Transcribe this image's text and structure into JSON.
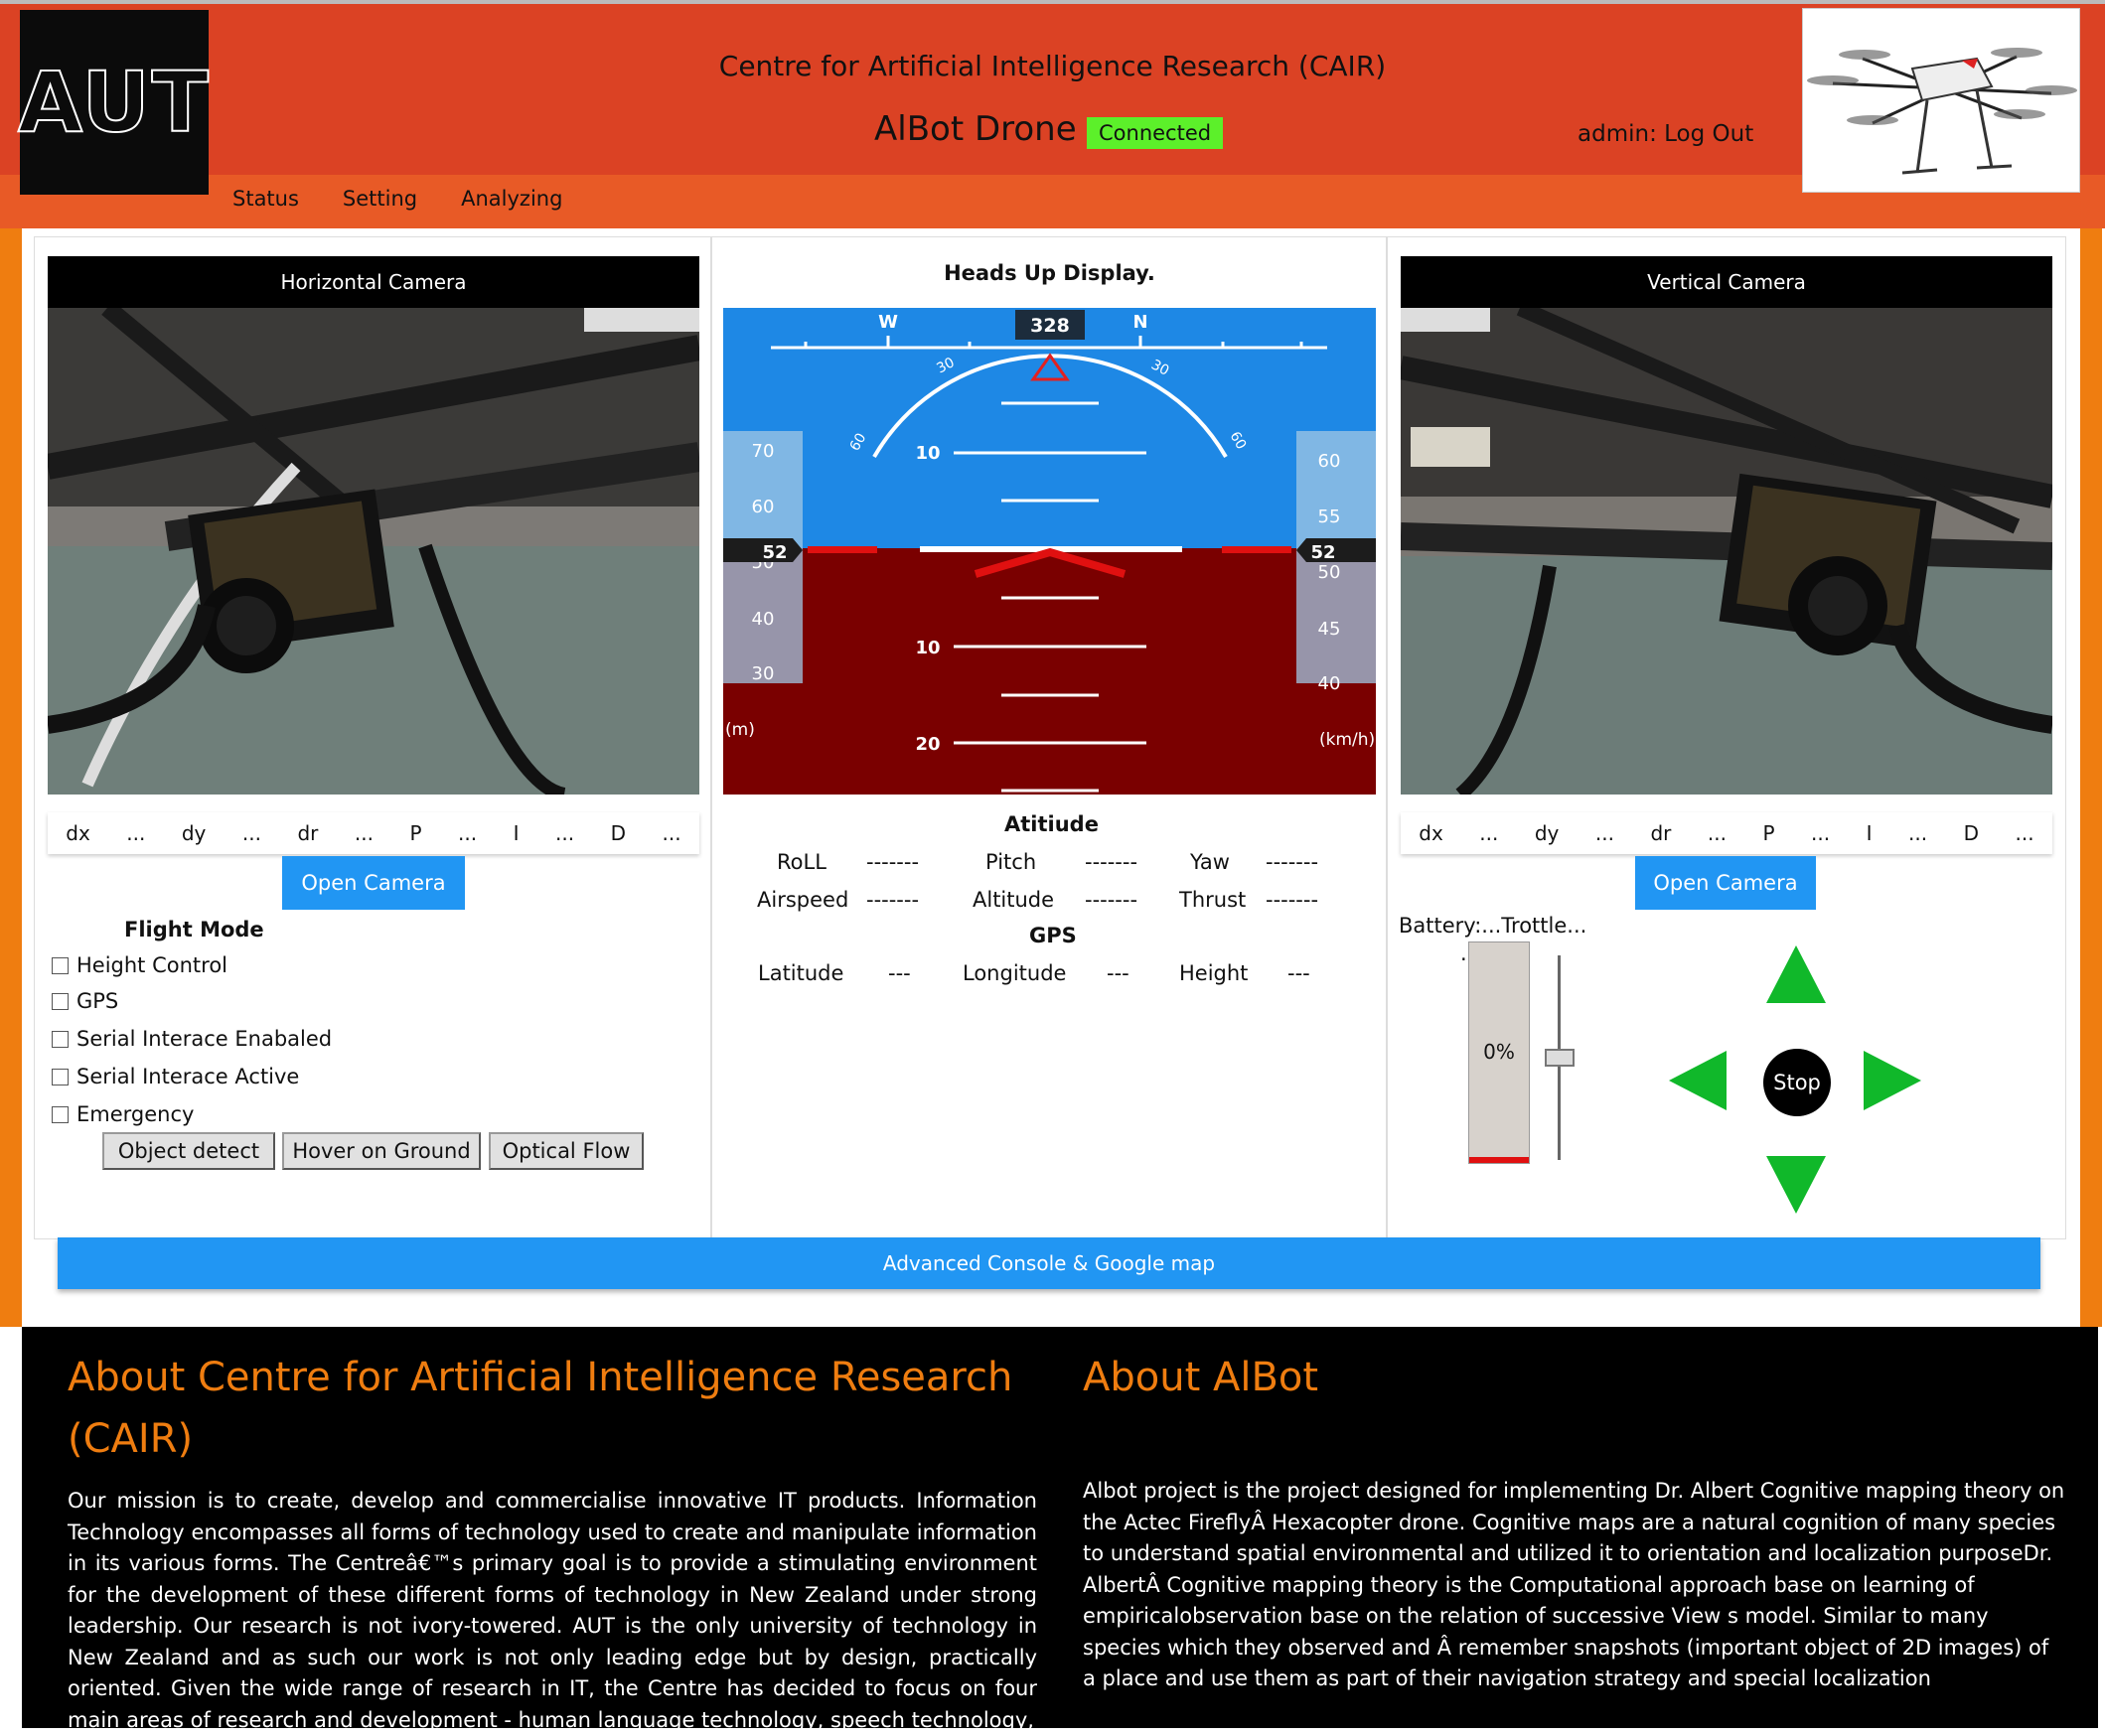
{
  "header": {
    "logo_text": "AUT",
    "org_title": "Centre for Artificial Intelligence Research (CAIR)",
    "app_title": "AlBot Drone",
    "connection_status": "Connected",
    "user_label": "admin: Log Out"
  },
  "nav": {
    "items": [
      "Status",
      "Setting",
      "Analyzing"
    ]
  },
  "left_camera": {
    "title": "Horizontal Camera",
    "pid": [
      "dx",
      "...",
      "dy",
      "...",
      "dr",
      "...",
      "P",
      "...",
      "I",
      "...",
      "D",
      "..."
    ],
    "open_button": "Open Camera"
  },
  "right_camera": {
    "title": "Vertical Camera",
    "pid": [
      "dx",
      "...",
      "dy",
      "...",
      "dr",
      "...",
      "P",
      "...",
      "I",
      "...",
      "D",
      "..."
    ],
    "open_button": "Open Camera"
  },
  "flight_mode": {
    "title": "Flight Mode",
    "options": [
      "Height Control",
      "GPS",
      "Serial Interace Enabaled",
      "Serial Interace Active",
      "Emergency"
    ],
    "buttons": [
      "Object detect",
      "Hover on Ground",
      "Optical Flow"
    ]
  },
  "hud": {
    "title": "Heads Up Display.",
    "heading": "328",
    "compass_letters": [
      "W",
      "N"
    ],
    "bank_labels": [
      "30",
      "30",
      "60",
      "60"
    ],
    "pitch_labels": [
      "10",
      "10",
      "20"
    ],
    "altitude_ticks": [
      "70",
      "60",
      "50",
      "40",
      "30"
    ],
    "altitude_value": "52",
    "altitude_unit": "(m)",
    "speed_ticks": [
      "60",
      "55",
      "50",
      "45",
      "40"
    ],
    "speed_value": "52",
    "speed_unit": "(km/h)"
  },
  "telemetry": {
    "attitude_title": "Atitiude",
    "row1": [
      "RoLL",
      "-------",
      "Pitch",
      "-------",
      "Yaw",
      "-------"
    ],
    "row2": [
      "Airspeed",
      "-------",
      "Altitude",
      "-------",
      "Thrust",
      "-------"
    ],
    "gps_title": "GPS",
    "row3": [
      "Latitude",
      "---",
      "Longitude",
      "---",
      "Height",
      "---"
    ]
  },
  "controls": {
    "battery_label": "Battery:...Trottle...",
    "battery_dot": ".",
    "battery_percent": "0%",
    "battery_level": 0,
    "stop_label": "Stop"
  },
  "advanced_button": "Advanced Console & Google map",
  "footer": {
    "cair_heading": "About Centre for Artificial Intelligence Research (CAIR)",
    "cair_text": "Our mission is to create, develop and commercialise innovative IT products. Information Technology encompasses all forms of technology used to create and manipulate information in its various forms. The Centreâ€™s primary goal is to provide a stimulating environment for the development of these different forms of technology in New Zealand under strong leadership. Our research is not ivory-towered. AUT is the only university of technology in New Zealand and as such our work is not only leading edge but by design, practically oriented. Given the wide range of research in IT, the Centre has decided to focus on four main areas of research and development - human language technology, speech technology,",
    "albot_heading": "About AlBot",
    "albot_text": "Albot project is the project designed for implementing Dr. Albert Cognitive mapping theory on the Actec FireflyÂ  Hexacopter drone. Cognitive maps are a natural cognition of many species to understand spatial environmental and utilized it to orientation and localization purposeDr. AlbertÂ  Cognitive mapping theory is the Computational approach base on learning of empiricalobservation base on the relation of successive View s model. Similar to many species which they observed and Â remember snapshots (important object of 2D images) of a place and use them as part of their navigation strategy and special localization"
  },
  "colors": {
    "header_red": "#db4224",
    "nav_orange": "#e85a26",
    "accent_orange": "#ef7d10",
    "button_blue": "#2196f3",
    "connected_green": "#5cf02a",
    "hud_sky": "#1e88e5",
    "hud_ground": "#7a0000",
    "arrow_green": "#10b82a"
  }
}
